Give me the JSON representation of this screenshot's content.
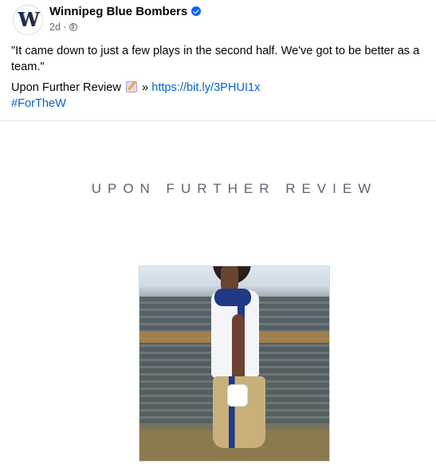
{
  "post": {
    "page_name": "Winnipeg Blue Bombers",
    "avatar_letter": "W",
    "time": "2d ·",
    "quote": "\"It came down to just a few plays in the second half. We've got to be better as a team.\"",
    "review_label": "Upon Further Review",
    "arrow": "»",
    "link": "https://bit.ly/3PHUI1x",
    "hashtag": "#ForTheW"
  },
  "media": {
    "title": "UPON FURTHER REVIEW"
  },
  "icons": {
    "verified": "verified-badge-icon",
    "audience": "globe-icon",
    "memo": "memo-emoji-icon"
  },
  "colors": {
    "link": "#0064d1",
    "verified": "#0866ff",
    "meta": "#65676b",
    "title": "#5a6475"
  }
}
